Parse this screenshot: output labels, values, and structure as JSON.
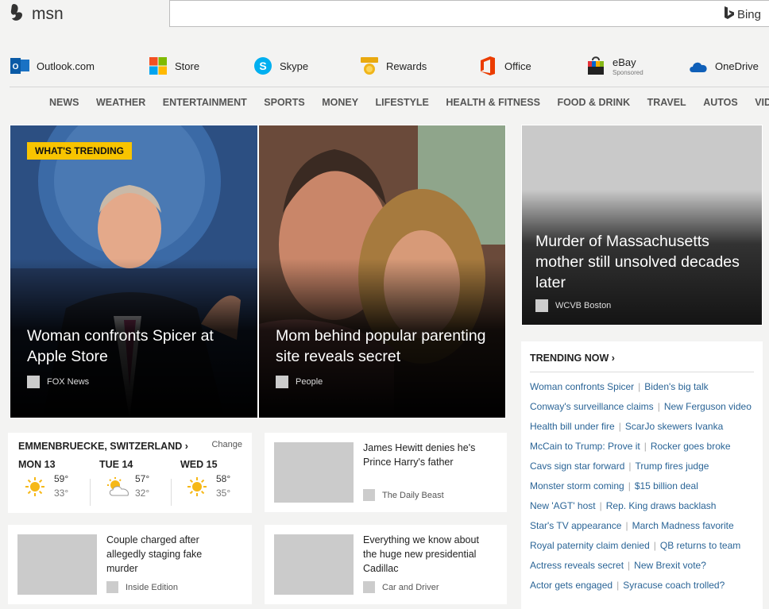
{
  "header": {
    "logo_text": "msn",
    "search_value": "",
    "bing_label": "Bing"
  },
  "quick_links": [
    {
      "label": "Outlook.com",
      "icon": "outlook-icon"
    },
    {
      "label": "Store",
      "icon": "microsoft-store-icon"
    },
    {
      "label": "Skype",
      "icon": "skype-icon"
    },
    {
      "label": "Rewards",
      "icon": "rewards-medal-icon"
    },
    {
      "label": "Office",
      "icon": "office-icon"
    },
    {
      "label": "eBay",
      "sub": "Sponsored",
      "icon": "ebay-bag-icon"
    },
    {
      "label": "OneDrive",
      "icon": "onedrive-cloud-icon"
    }
  ],
  "nav": [
    "NEWS",
    "WEATHER",
    "ENTERTAINMENT",
    "SPORTS",
    "MONEY",
    "LIFESTYLE",
    "HEALTH & FITNESS",
    "FOOD & DRINK",
    "TRAVEL",
    "AUTOS",
    "VIDEO"
  ],
  "hero": [
    {
      "badge": "WHAT'S TRENDING",
      "headline": "Woman confronts Spicer at Apple Store",
      "source": "FOX News"
    },
    {
      "headline": "Mom behind popular parenting site reveals secret",
      "source": "People"
    }
  ],
  "right_tile": {
    "headline": "Murder of Massachusetts mother still unsolved decades later",
    "source": "WCVB Boston"
  },
  "trending": {
    "title": "TRENDING NOW",
    "rows": [
      [
        "Woman confronts Spicer",
        "Biden's big talk"
      ],
      [
        "Conway's surveillance claims",
        "New Ferguson video"
      ],
      [
        "Health bill under fire",
        "ScarJo skewers Ivanka"
      ],
      [
        "McCain to Trump: Prove it",
        "Rocker goes broke"
      ],
      [
        "Cavs sign star forward",
        "Trump fires judge"
      ],
      [
        "Monster storm coming",
        "$15 billion deal"
      ],
      [
        "New 'AGT' host",
        "Rep. King draws backlash"
      ],
      [
        "Star's TV appearance",
        "March Madness favorite"
      ],
      [
        "Royal paternity claim denied",
        "QB returns to team"
      ],
      [
        "Actress reveals secret",
        "New Brexit vote?"
      ],
      [
        "Actor gets engaged",
        "Syracuse coach trolled?"
      ]
    ]
  },
  "weather": {
    "location": "EMMENBRUECKE, SWITZERLAND",
    "change_label": "Change",
    "days": [
      {
        "day": "MON 13",
        "hi": "59°",
        "lo": "33°",
        "icon": "sunny-icon"
      },
      {
        "day": "TUE 14",
        "hi": "57°",
        "lo": "32°",
        "icon": "partly-cloudy-icon"
      },
      {
        "day": "WED 15",
        "hi": "58°",
        "lo": "35°",
        "icon": "sunny-icon"
      }
    ]
  },
  "cards": [
    {
      "title": "James Hewitt denies he's Prince Harry's father",
      "source": "The Daily Beast"
    },
    {
      "title": "Couple charged after allegedly staging fake murder",
      "source": "Inside Edition"
    },
    {
      "title": "Everything we know about the huge new presidential Cadillac",
      "source": "Car and Driver"
    }
  ],
  "colors": {
    "accent_badge": "#f8c400",
    "link": "#2a6496",
    "page_bg": "#f3f3f2"
  }
}
